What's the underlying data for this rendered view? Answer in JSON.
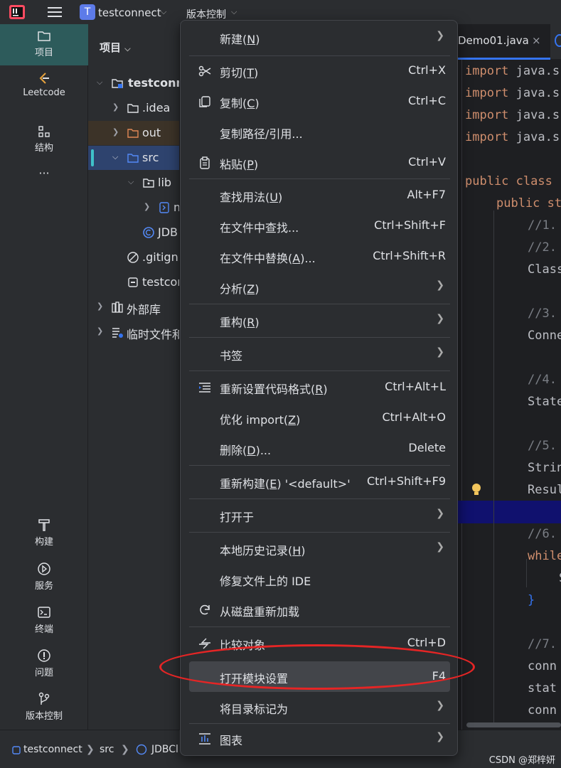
{
  "titlebar": {
    "project_badge": "T",
    "project_name": "testconnect",
    "vcs_label": "版本控制"
  },
  "toolstrip": {
    "top": [
      {
        "label": "项目",
        "icon": "folder-icon"
      },
      {
        "label": "Leetcode",
        "icon": "leetcode-icon"
      },
      {
        "label": "结构",
        "icon": "structure-icon"
      },
      {
        "label": "···",
        "icon": "more-icon"
      }
    ],
    "bottom": [
      {
        "label": "构建",
        "icon": "hammer-icon"
      },
      {
        "label": "服务",
        "icon": "services-icon"
      },
      {
        "label": "终端",
        "icon": "terminal-icon"
      },
      {
        "label": "问题",
        "icon": "problems-icon"
      },
      {
        "label": "版本控制",
        "icon": "vcs-icon"
      }
    ]
  },
  "project_panel": {
    "title": "项目",
    "tree": [
      {
        "label": "testconne",
        "bold": true
      },
      {
        "label": ".idea"
      },
      {
        "label": "out"
      },
      {
        "label": "src"
      },
      {
        "label": "lib"
      },
      {
        "label": "m"
      },
      {
        "label": "JDB"
      },
      {
        "label": ".gitign"
      },
      {
        "label": "testcor"
      },
      {
        "label": "外部库"
      },
      {
        "label": "临时文件和"
      }
    ]
  },
  "editor": {
    "tab_label": "Demo01.java",
    "tab_close": "×",
    "lines": [
      {
        "kw": "import",
        "tx": " java.s"
      },
      {
        "kw": "import",
        "tx": " java.s"
      },
      {
        "kw": "import",
        "tx": " java.s"
      },
      {
        "kw": "import",
        "tx": " java.s"
      },
      {
        "kw": "public class",
        "tx": ""
      },
      {
        "kw": "public st",
        "tx": ""
      },
      {
        "cm": "//1."
      },
      {
        "cm": "//2."
      },
      {
        "tx": "Class"
      },
      {
        "cm": "//3."
      },
      {
        "tx": "Conne"
      },
      {
        "cm": "//4."
      },
      {
        "tx": "State"
      },
      {
        "cm": "//5."
      },
      {
        "tx": "Strin"
      },
      {
        "tx": "Resul"
      },
      {
        "cm": "//6."
      },
      {
        "kw": "while"
      },
      {
        "tx": "S"
      },
      {
        "br": "}"
      },
      {
        "cm": "//7."
      },
      {
        "tx": "conn"
      },
      {
        "tx": "stat"
      },
      {
        "tx": "conn"
      }
    ]
  },
  "statusbar": {
    "crumbs": [
      "testconnect",
      "src",
      "JDBCl"
    ],
    "watermark": "CSDN @郑梓妍"
  },
  "context_menu": {
    "items": [
      {
        "label": "新建(",
        "mn": "N",
        "after": ")",
        "shortcut": "",
        "submenu": true,
        "icon": ""
      },
      {
        "label": "剪切(",
        "mn": "T",
        "after": ")",
        "shortcut": "Ctrl+X",
        "submenu": false,
        "icon": "scissors-icon"
      },
      {
        "label": "复制(",
        "mn": "C",
        "after": ")",
        "shortcut": "Ctrl+C",
        "submenu": false,
        "icon": "copy-icon"
      },
      {
        "label": "复制路径/引用...",
        "mn": "",
        "after": "",
        "shortcut": "",
        "submenu": false,
        "icon": ""
      },
      {
        "label": "粘贴(",
        "mn": "P",
        "after": ")",
        "shortcut": "Ctrl+V",
        "submenu": false,
        "icon": "clipboard-icon"
      },
      {
        "label": "查找用法(",
        "mn": "U",
        "after": ")",
        "shortcut": "Alt+F7",
        "submenu": false,
        "icon": ""
      },
      {
        "label": "在文件中查找...",
        "mn": "",
        "after": "",
        "shortcut": "Ctrl+Shift+F",
        "submenu": false,
        "icon": ""
      },
      {
        "label": "在文件中替换(",
        "mn": "A",
        "after": ")...",
        "shortcut": "Ctrl+Shift+R",
        "submenu": false,
        "icon": ""
      },
      {
        "label": "分析(",
        "mn": "Z",
        "after": ")",
        "shortcut": "",
        "submenu": true,
        "icon": ""
      },
      {
        "label": "重构(",
        "mn": "R",
        "after": ")",
        "shortcut": "",
        "submenu": true,
        "icon": ""
      },
      {
        "label": "书签",
        "mn": "",
        "after": "",
        "shortcut": "",
        "submenu": true,
        "icon": ""
      },
      {
        "label": "重新设置代码格式(",
        "mn": "R",
        "after": ")",
        "shortcut": "Ctrl+Alt+L",
        "submenu": false,
        "icon": "reformat-icon"
      },
      {
        "label": "优化 import(",
        "mn": "Z",
        "after": ")",
        "shortcut": "Ctrl+Alt+O",
        "submenu": false,
        "icon": ""
      },
      {
        "label": "删除(",
        "mn": "D",
        "after": ")...",
        "shortcut": "Delete",
        "submenu": false,
        "icon": ""
      },
      {
        "label": "重新构建(",
        "mn": "E",
        "after": ") '<default>'",
        "shortcut": "Ctrl+Shift+F9",
        "submenu": false,
        "icon": ""
      },
      {
        "label": "打开于",
        "mn": "",
        "after": "",
        "shortcut": "",
        "submenu": true,
        "icon": ""
      },
      {
        "label": "本地历史记录(",
        "mn": "H",
        "after": ")",
        "shortcut": "",
        "submenu": true,
        "icon": ""
      },
      {
        "label": "修复文件上的 IDE",
        "mn": "",
        "after": "",
        "shortcut": "",
        "submenu": false,
        "icon": ""
      },
      {
        "label": "从磁盘重新加载",
        "mn": "",
        "after": "",
        "shortcut": "",
        "submenu": false,
        "icon": "reload-icon"
      },
      {
        "label": "比较对象",
        "mn": "",
        "after": "",
        "shortcut": "Ctrl+D",
        "submenu": false,
        "icon": "compare-icon"
      },
      {
        "label": "打开模块设置",
        "mn": "",
        "after": "",
        "shortcut": "F4",
        "submenu": false,
        "icon": ""
      },
      {
        "label": "将目录标记为",
        "mn": "",
        "after": "",
        "shortcut": "",
        "submenu": true,
        "icon": ""
      },
      {
        "label": "图表",
        "mn": "",
        "after": "",
        "shortcut": "",
        "submenu": true,
        "icon": "diagram-icon"
      }
    ]
  },
  "colors": {
    "annotation": "#e52525",
    "accent": "#3574f0",
    "active_tool": "#2d5b5b"
  }
}
